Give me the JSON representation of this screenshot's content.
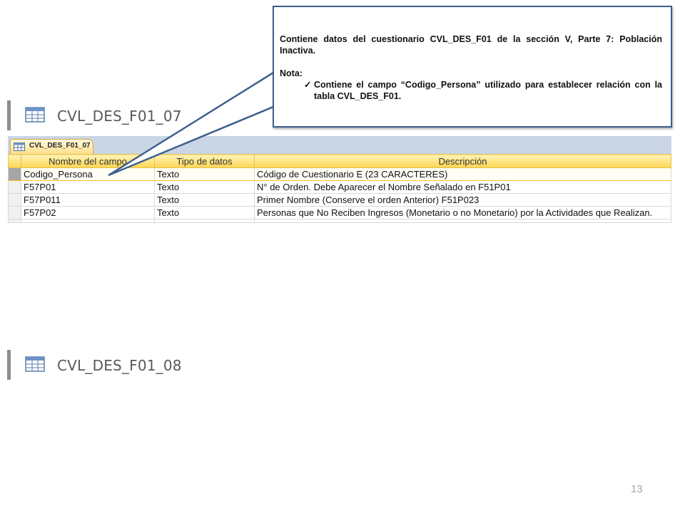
{
  "sections": [
    {
      "title": "CVL_DES_F01_07"
    },
    {
      "title": "CVL_DES_F01_08"
    }
  ],
  "table": {
    "tab_label": "CVL_DES_F01_07",
    "headers": [
      "Nombre del campo",
      "Tipo de datos",
      "Descripción"
    ],
    "rows": [
      {
        "name": "Codigo_Persona",
        "type": "Texto",
        "desc": "Código de Cuestionario E (23 CARACTERES)"
      },
      {
        "name": "F57P01",
        "type": "Texto",
        "desc": "N° de Orden. Debe Aparecer el Nombre Señalado en F51P01"
      },
      {
        "name": "F57P011",
        "type": "Texto",
        "desc": "Primer Nombre (Conserve el orden Anterior) F51P023"
      },
      {
        "name": "F57P02",
        "type": "Texto",
        "desc": "Personas que No Reciben Ingresos (Monetario o no Monetario) por la Actividades que Realizan."
      }
    ]
  },
  "callout": {
    "text": "Contiene datos del cuestionario CVL_DES_F01 de la sección V, Parte 7: Población Inactiva.",
    "note_label": "Nota:",
    "bullet": "Contiene el campo “Codigo_Persona” utilizado para establecer relación con la tabla CVL_DES_F01.",
    "bullet_icon": "check-icon"
  },
  "page_number": "13",
  "colors": {
    "callout_border": "#3d5f8e",
    "header_fill": "#ffd64f",
    "tab_strip": "#cad6e5",
    "accent_bar": "#8c8c8c"
  }
}
